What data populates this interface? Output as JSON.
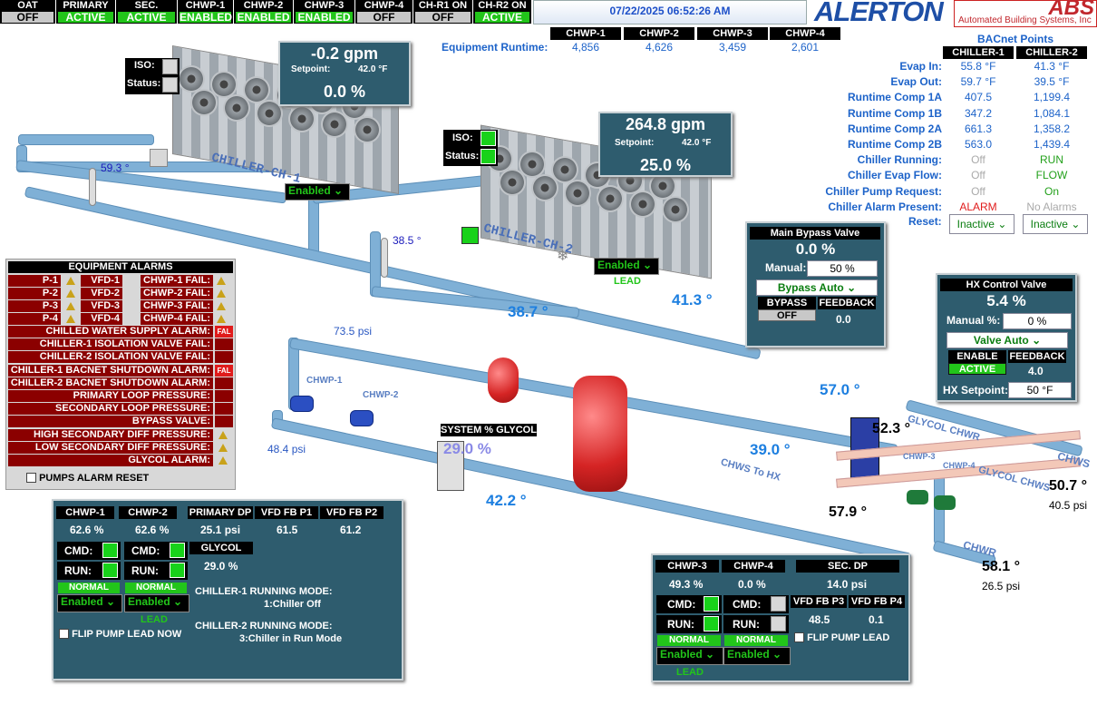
{
  "status_bar": [
    {
      "label": "OAT",
      "value": "OFF",
      "state": "off"
    },
    {
      "label": "PRIMARY",
      "value": "ACTIVE",
      "state": "on"
    },
    {
      "label": "SEC.",
      "value": "ACTIVE",
      "state": "on"
    },
    {
      "label": "CHWP-1",
      "value": "ENABLED",
      "state": "on"
    },
    {
      "label": "CHWP-2",
      "value": "ENABLED",
      "state": "on"
    },
    {
      "label": "CHWP-3",
      "value": "ENABLED",
      "state": "on"
    },
    {
      "label": "CHWP-4",
      "value": "OFF",
      "state": "off"
    },
    {
      "label": "CH-R1 ON",
      "value": "OFF",
      "state": "off"
    },
    {
      "label": "CH-R2 ON",
      "value": "ACTIVE",
      "state": "on"
    }
  ],
  "datetime": "07/22/2025 06:52:26 AM",
  "logo": {
    "alerton": "ALERTON",
    "abs": "ABS",
    "abs_sub": "Automated Building Systems, Inc"
  },
  "runtime": {
    "label": "Equipment Runtime:",
    "headers": [
      "CHWP-1",
      "CHWP-2",
      "CHWP-3",
      "CHWP-4"
    ],
    "values": [
      "4,856",
      "4,626",
      "3,459",
      "2,601"
    ]
  },
  "bacnet": {
    "title": "BACnet Points",
    "headers": [
      "CHILLER-1",
      "CHILLER-2"
    ],
    "rows": [
      {
        "label": "Evap In:",
        "c1": "55.8 °F",
        "c2": "41.3 °F",
        "col": "bl"
      },
      {
        "label": "Evap Out:",
        "c1": "59.7 °F",
        "c2": "39.5 °F",
        "col": "bl"
      },
      {
        "label": "Runtime Comp 1A",
        "c1": "407.5",
        "c2": "1,199.4",
        "col": "bl"
      },
      {
        "label": "Runtime Comp 1B",
        "c1": "347.2",
        "c2": "1,084.1",
        "col": "bl"
      },
      {
        "label": "Runtime Comp 2A",
        "c1": "661.3",
        "c2": "1,358.2",
        "col": "bl"
      },
      {
        "label": "Runtime Comp 2B",
        "c1": "563.0",
        "c2": "1,439.4",
        "col": "bl"
      },
      {
        "label": "Chiller Running:",
        "c1": "Off",
        "c2": "RUN",
        "col": "state"
      },
      {
        "label": "Chiller Evap Flow:",
        "c1": "Off",
        "c2": "FLOW",
        "col": "state"
      },
      {
        "label": "Chiller Pump Request:",
        "c1": "Off",
        "c2": "On",
        "col": "state"
      },
      {
        "label": "Chiller Alarm Present:",
        "c1": "ALARM",
        "c2": "No Alarms",
        "col": "alarm"
      }
    ],
    "reset_label": "Reset:",
    "reset_c1": "Inactive",
    "reset_c2": "Inactive"
  },
  "chiller1": {
    "iso": "ISO:",
    "status": "Status:",
    "flow": "-0.2 gpm",
    "setpoint_label": "Setpoint:",
    "setpoint": "42.0 °F",
    "pct": "0.0 %",
    "name": "CHILLER-CH-1",
    "enabled": "Enabled",
    "temp": "59.3 °"
  },
  "chiller2": {
    "iso": "ISO:",
    "status": "Status:",
    "flow": "264.8 gpm",
    "setpoint_label": "Setpoint:",
    "setpoint": "42.0 °F",
    "pct": "25.0 %",
    "name": "CHILLER-CH-2",
    "enabled": "Enabled",
    "lead": "LEAD",
    "temp": "38.5 °"
  },
  "bypass": {
    "title": "Main Bypass Valve",
    "pct": "0.0 %",
    "manual_label": "Manual:",
    "manual": "50 %",
    "mode": "Bypass Auto",
    "bypass_label": "BYPASS",
    "feedback_label": "FEEDBACK",
    "bypass_state": "OFF",
    "feedback": "0.0"
  },
  "hx": {
    "title": "HX Control Valve",
    "pct": "5.4 %",
    "manual_label": "Manual %:",
    "manual": "0 %",
    "mode": "Valve Auto",
    "enable_label": "ENABLE",
    "feedback_label": "FEEDBACK",
    "enable_state": "ACTIVE",
    "feedback": "4.0",
    "setpoint_label": "HX Setpoint:",
    "setpoint": "50 °F"
  },
  "pipe_labels": {
    "t1": "38.7 °",
    "t2": "41.3 °",
    "t3": "57.0 °",
    "t4": "39.0 °",
    "t5": "42.2 °",
    "p1": "73.5 psi",
    "p2": "48.4 psi",
    "glycol_label": "SYSTEM % GLYCOL",
    "glycol": "29.0 %",
    "hx_t1": "52.3 °",
    "hx_t2": "57.9 °",
    "chws_t": "50.7 °",
    "chws_p": "40.5 psi",
    "chwr_t": "58.1 °",
    "chwr_p": "26.5 psi",
    "chwp1": "CHWP-1",
    "chwp2": "CHWP-2",
    "chwp3": "CHWP-3",
    "chwp4": "CHWP-4",
    "glycol_chwr": "GLYCOL CHWR",
    "glycol_chws": "GLYCOL CHWS",
    "chws": "CHWS",
    "chwr": "CHWR",
    "chws_to_hx": "CHWS To HX"
  },
  "alarms": {
    "title": "EQUIPMENT ALARMS",
    "hand": [
      "P-1 HAND:",
      "P-2 HAND:",
      "P-3 HAND:",
      "P-4 HAND:"
    ],
    "vfd": [
      "VFD-1",
      "VFD-2",
      "VFD-3",
      "VFD-4"
    ],
    "fail": [
      "CHWP-1 FAIL:",
      "CHWP-2 FAIL:",
      "CHWP-3 FAIL:",
      "CHWP-4 FAIL:"
    ],
    "rows": [
      "CHILLED WATER SUPPLY ALARM:",
      "CHILLER-1 ISOLATION VALVE FAIL:",
      "CHILLER-2 ISOLATION VALVE FAIL:",
      "CHILLER-1 BACNET SHUTDOWN ALARM:",
      "CHILLER-2 BACNET SHUTDOWN ALARM:",
      "PRIMARY LOOP PRESSURE:",
      "SECONDARY LOOP PRESSURE:",
      "BYPASS VALVE:",
      "HIGH SECONDARY DIFF PRESSURE:",
      "LOW SECONDARY DIFF PRESSURE:",
      "GLYCOL ALARM:"
    ],
    "fal": "FAL",
    "reset": "PUMPS ALARM RESET"
  },
  "primary_panel": {
    "h1": "CHWP-1",
    "h2": "CHWP-2",
    "h3": "PRIMARY DP",
    "h4": "VFD FB P1",
    "h5": "VFD FB P2",
    "v1": "62.6 %",
    "v2": "62.6 %",
    "v3": "25.1 psi",
    "v4": "61.5",
    "v5": "61.2",
    "glycol_label": "GLYCOL",
    "glycol": "29.0 %",
    "cmd": "CMD:",
    "run": "RUN:",
    "normal": "NORMAL",
    "enabled": "Enabled",
    "lead": "LEAD",
    "mode1_label": "CHILLER-1 RUNNING MODE:",
    "mode1": "1:Chiller Off",
    "mode2_label": "CHILLER-2 RUNNING MODE:",
    "mode2": "3:Chiller in Run Mode",
    "flip": "FLIP PUMP LEAD NOW"
  },
  "secondary_panel": {
    "h1": "CHWP-3",
    "h2": "CHWP-4",
    "h3": "SEC. DP",
    "v1": "49.3 %",
    "v2": "0.0 %",
    "v3": "14.0 psi",
    "h4": "VFD FB P3",
    "h5": "VFD FB P4",
    "v4": "48.5",
    "v5": "0.1",
    "cmd": "CMD:",
    "run": "RUN:",
    "normal": "NORMAL",
    "enabled": "Enabled",
    "lead": "LEAD",
    "flip": "FLIP PUMP LEAD"
  }
}
